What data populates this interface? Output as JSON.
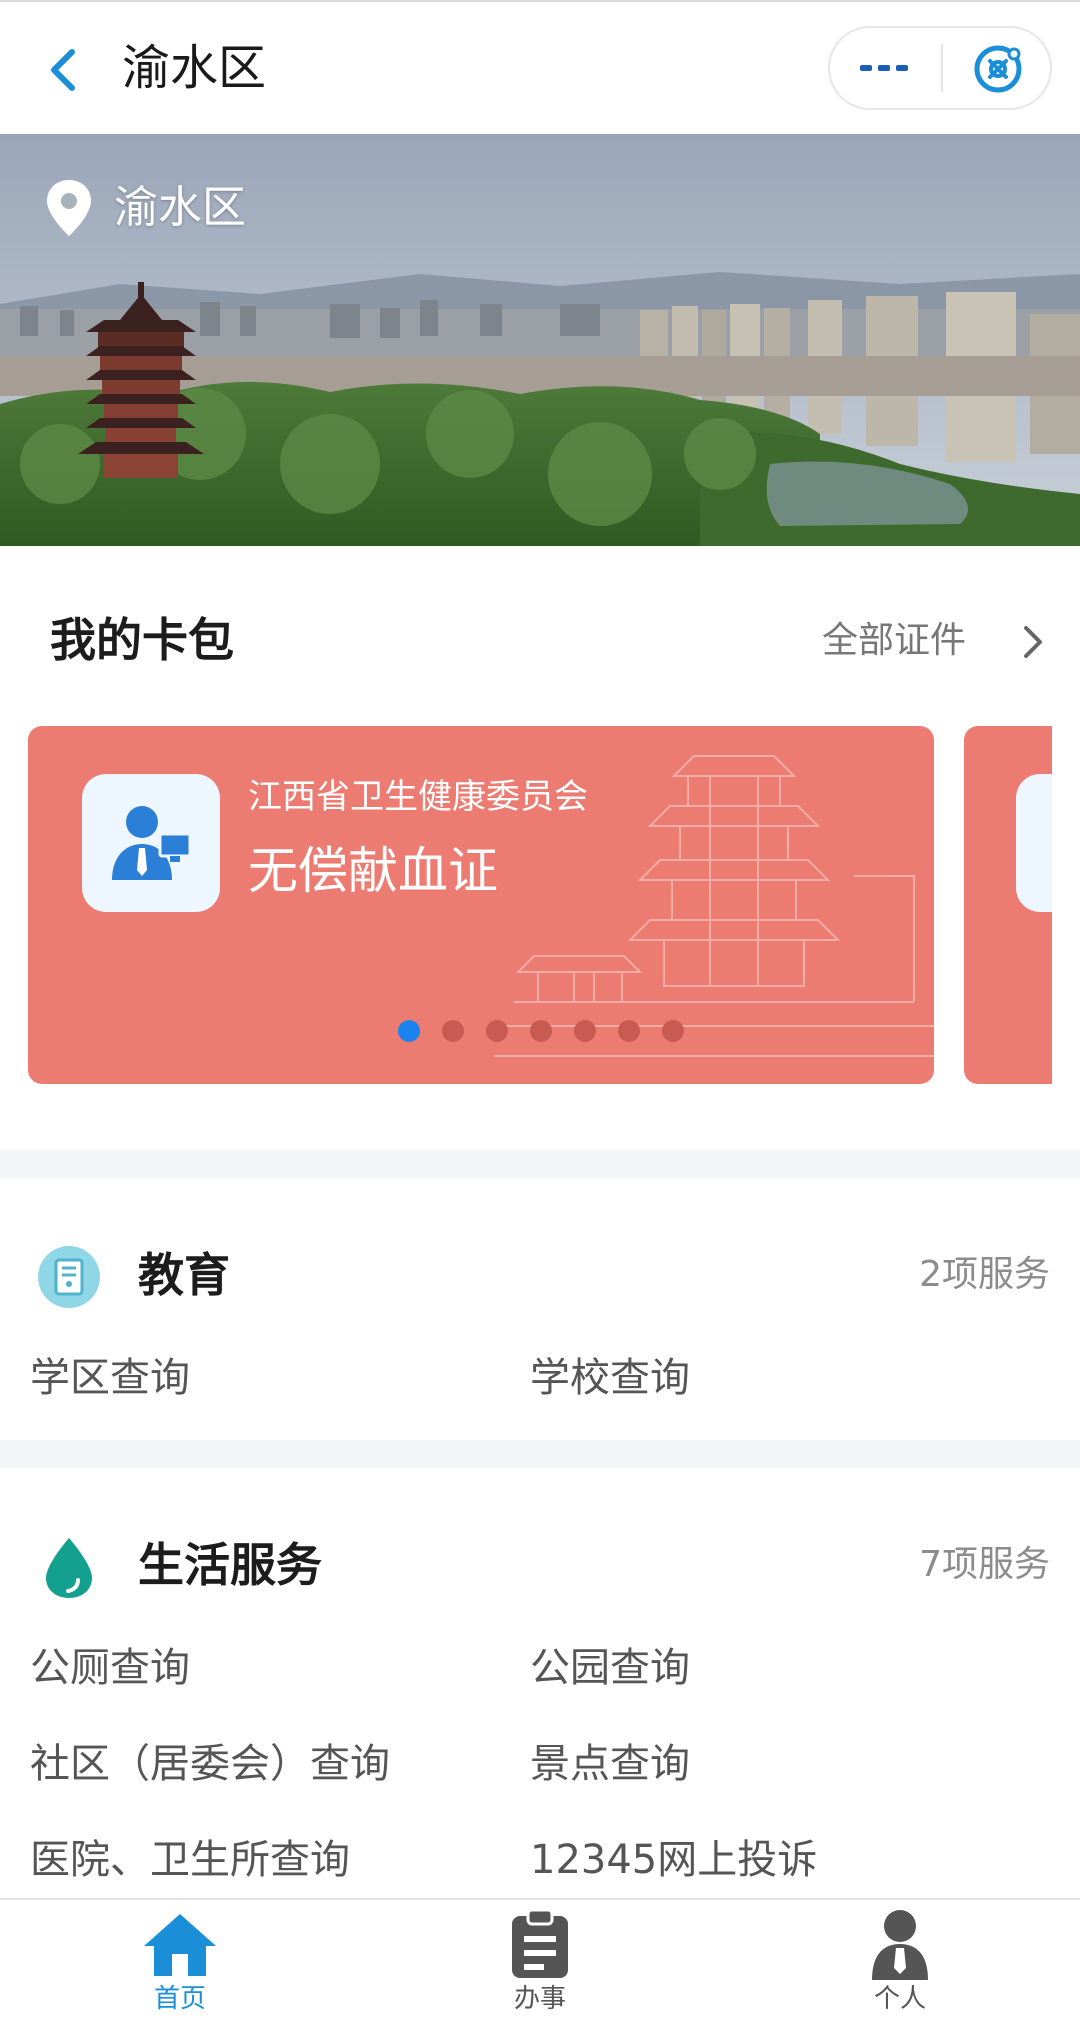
{
  "header": {
    "title": "渝水区",
    "back_icon": "chevron-left-icon",
    "more_icon": "more-dots-icon",
    "close_icon": "close-circle-icon",
    "accent": "#1a8fd8"
  },
  "banner": {
    "location_icon": "location-pin-icon",
    "location_text": "渝水区"
  },
  "wallet": {
    "title": "我的卡包",
    "all_label": "全部证件",
    "card": {
      "org": "江西省卫生健康委员会",
      "name": "无偿献血证",
      "icon": "person-computer-icon",
      "color": "#ec7b72"
    },
    "carousel": {
      "count": 7,
      "active_index": 0
    }
  },
  "sections": [
    {
      "title": "教育",
      "icon": "book-icon",
      "count": "2项服务",
      "items": [
        "学区查询",
        "学校查询"
      ]
    },
    {
      "title": "生活服务",
      "icon": "water-drop-icon",
      "count": "7项服务",
      "items": [
        "公厕查询",
        "公园查询",
        "社区（居委会）查询",
        "景点查询",
        "医院、卫生所查询",
        "12345网上投诉"
      ]
    }
  ],
  "tabbar": {
    "items": [
      {
        "label": "首页",
        "icon": "home-icon",
        "active": true
      },
      {
        "label": "办事",
        "icon": "clipboard-icon",
        "active": false
      },
      {
        "label": "个人",
        "icon": "person-icon",
        "active": false
      }
    ],
    "active_color": "#1a8fd8",
    "inactive_color": "#555555"
  }
}
